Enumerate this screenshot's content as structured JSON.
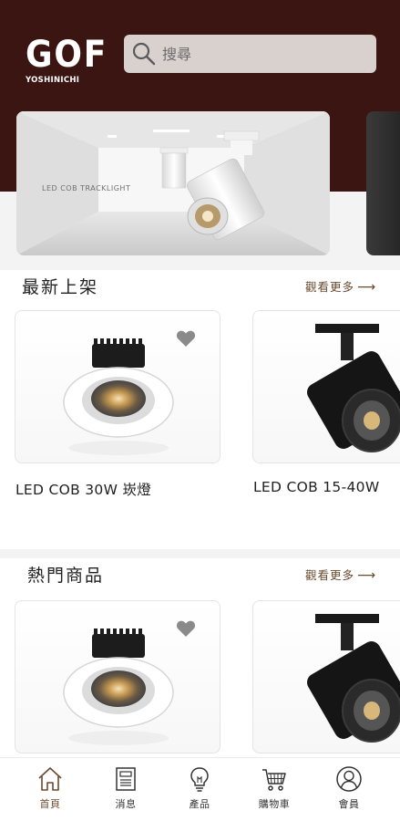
{
  "header": {
    "logo_main": "GOF",
    "logo_sub": "YOSHINICHI",
    "search_placeholder": "搜尋",
    "brand_color": "#3b1512"
  },
  "banner": {
    "caption": "LED COB TRACKLIGHT"
  },
  "sections": [
    {
      "title": "最新上架",
      "more_label": "觀看更多",
      "products": [
        {
          "name": "LED COB 30W 崁燈",
          "favorite_icon": "heart-icon"
        },
        {
          "name": "LED COB 15-40W"
        }
      ]
    },
    {
      "title": "熱門商品",
      "more_label": "觀看更多",
      "products": [
        {
          "name": "",
          "favorite_icon": "heart-icon"
        },
        {
          "name": ""
        }
      ]
    }
  ],
  "bottom_nav": {
    "items": [
      {
        "label": "首頁",
        "icon": "home-icon",
        "active": true
      },
      {
        "label": "消息",
        "icon": "news-icon",
        "active": false
      },
      {
        "label": "產品",
        "icon": "lightbulb-icon",
        "active": false
      },
      {
        "label": "購物車",
        "icon": "cart-icon",
        "active": false
      },
      {
        "label": "會員",
        "icon": "user-icon",
        "active": false
      }
    ],
    "accent_color": "#6b4a2e"
  }
}
